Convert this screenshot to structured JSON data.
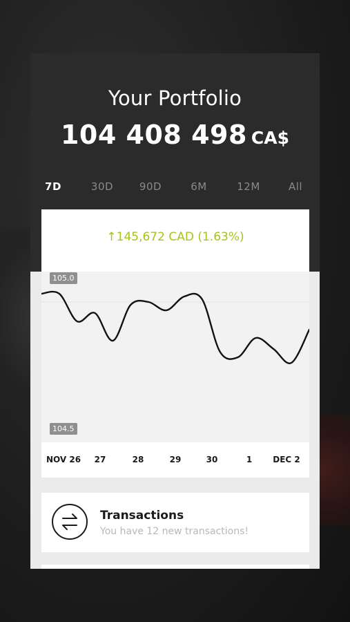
{
  "portfolio": {
    "title": "Your Portfolio",
    "value": "104 408 498",
    "currency": "CA$"
  },
  "tabs": [
    {
      "label": "7D",
      "active": true
    },
    {
      "label": "30D",
      "active": false
    },
    {
      "label": "90D",
      "active": false
    },
    {
      "label": "6M",
      "active": false
    },
    {
      "label": "12M",
      "active": false
    },
    {
      "label": "All",
      "active": false
    }
  ],
  "change": {
    "arrow": "↑",
    "text": "145,672 CAD (1.63%)",
    "color": "#a6c31c"
  },
  "chart_data": {
    "type": "line",
    "x": [
      "NOV 26",
      "27",
      "28",
      "29",
      "30",
      "1",
      "DEC 2"
    ],
    "ytick_labels": [
      "105.0",
      "104.5"
    ],
    "ylim": [
      104.5,
      105.0
    ],
    "series": [
      {
        "values": [
          104.99,
          104.99,
          104.89,
          104.92,
          104.82,
          104.95,
          104.96,
          104.93,
          104.98,
          104.97,
          104.78,
          104.76,
          104.83,
          104.79,
          104.74,
          104.86
        ]
      }
    ],
    "grid": true
  },
  "transactions": {
    "title": "Transactions",
    "subtitle": "You have 12 new transactions!",
    "icon": "transfer-arrows-icon"
  }
}
